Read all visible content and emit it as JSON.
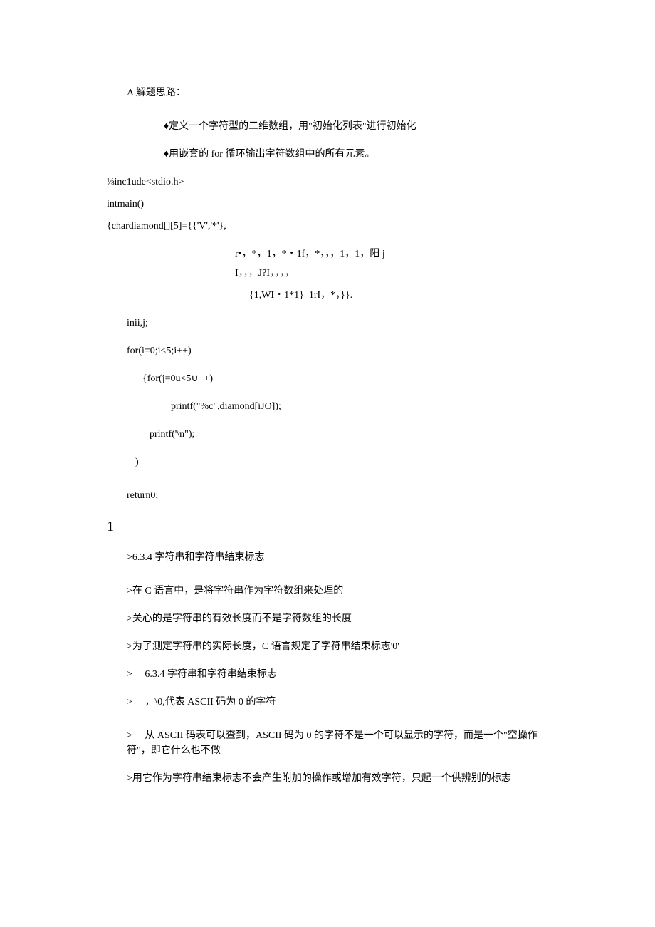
{
  "lines": {
    "l1": "A 解题思路：",
    "l2": "♦定义一个字符型的二维数组，用\"初始化列表\"进行初始化",
    "l3": "♦用嵌套的 for 循环输出字符数组中的所有元素。",
    "l4": "⅛inc1ude<stdio.h>",
    "l5": "intmain()",
    "l6": "{chardiamond[][5]={{'V','*'},",
    "l7": "r•，*，1，*・1f，*，，，1，1，阳 j",
    "l8": "I，，，J?I，，，，",
    "l9": "{1,WI・1*1}  1rI，*，}}.",
    "l10": "inii,j;",
    "l11": "for(i=0;i<5;i++)",
    "l12": "{for(j=0u<5∪++)",
    "l13": "printf(\"%c\",diamond[iJO]);",
    "l14": "printf('\\n\");",
    "l15": ")",
    "l16": "return0;",
    "l17": "1",
    "l18": ">6.3.4 字符串和字符串结束标志",
    "l19": ">在 C 语言中，是将字符串作为字符数组来处理的",
    "l20": ">关心的是字符串的有效长度而不是字符数组的长度",
    "l21": ">为了测定字符串的实际长度，C 语言规定了字符串结束标志'0'",
    "l22": ">     6.3.4 字符串和字符串结束标志",
    "l23": ">     ，\\0,代表 ASCII 码为 0 的字符",
    "l24": ">     从 ASCII 码表可以查到，ASCII 码为 0 的字符不是一个可以显示的字符，而是一个\"空操作符\"，即它什么也不做",
    "l25": ">用它作为字符串结束标志不会产生附加的操作或增加有效字符，只起一个供辨别的标志"
  }
}
